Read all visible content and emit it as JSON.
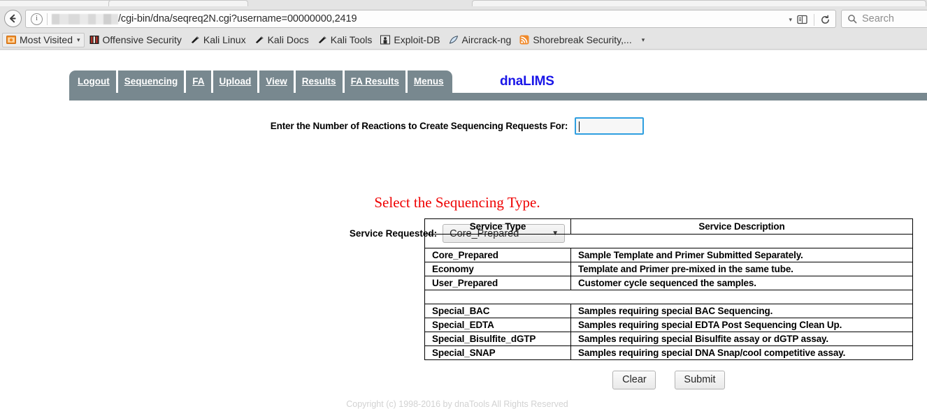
{
  "browser": {
    "url_prefix_redacted": true,
    "url": "/cgi-bin/dna/seqreq2N.cgi?username=00000000,2419",
    "search_placeholder": "Search",
    "back_icon": "back-arrow-icon",
    "info_icon": "page-info-icon",
    "reader_icon": "reader-view-icon",
    "reload_icon": "reload-icon",
    "dropdown_caret": "▾",
    "search_icon": "search-icon",
    "bookmarks": [
      {
        "label": "Most Visited",
        "icon": "most-visited-icon",
        "caret": "▾"
      },
      {
        "label": "Offensive Security",
        "icon": "offensive-security-icon"
      },
      {
        "label": "Kali Linux",
        "icon": "kali-icon"
      },
      {
        "label": "Kali Docs",
        "icon": "kali-icon"
      },
      {
        "label": "Kali Tools",
        "icon": "kali-icon"
      },
      {
        "label": "Exploit-DB",
        "icon": "exploit-db-icon"
      },
      {
        "label": "Aircrack-ng",
        "icon": "aircrack-icon"
      },
      {
        "label": "Shorebreak Security,...",
        "icon": "rss-feed-icon"
      }
    ],
    "bookmarks_overflow_caret": "▾"
  },
  "app": {
    "brand": "dnaLIMS",
    "brand_color": "#1a16e8",
    "navbar_color": "#78888f",
    "tabs": [
      {
        "label": "Logout"
      },
      {
        "label": "Sequencing"
      },
      {
        "label": "FA"
      },
      {
        "label": "Upload"
      },
      {
        "label": "View"
      },
      {
        "label": "Results"
      },
      {
        "label": "FA Results"
      },
      {
        "label": "Menus"
      }
    ]
  },
  "form": {
    "reactions_label": "Enter the Number of Reactions to Create Sequencing Requests For:",
    "reactions_value": "",
    "select_type_message": "Select the Sequencing Type.",
    "select_type_color": "#ef0000",
    "service_requested_label": "Service Requested:",
    "service_requested_value": "Core_Prepared",
    "select_caret": "▼",
    "clear_label": "Clear",
    "submit_label": "Submit"
  },
  "table": {
    "headers": [
      "Service Type",
      "Service Description"
    ],
    "rows": [
      {
        "spacer": true
      },
      {
        "type": "Core_Prepared",
        "description": "Sample Template and Primer Submitted Separately."
      },
      {
        "type": "Economy",
        "description": "Template and Primer pre-mixed in the same tube."
      },
      {
        "type": "User_Prepared",
        "description": "Customer cycle sequenced the samples."
      },
      {
        "spacer": true
      },
      {
        "type": "Special_BAC",
        "description": "Samples requiring special BAC Sequencing."
      },
      {
        "type": "Special_EDTA",
        "description": "Samples requiring special EDTA Post Sequencing Clean Up."
      },
      {
        "type": "Special_Bisulfite_dGTP",
        "description": "Samples requiring special Bisulfite assay or dGTP assay."
      },
      {
        "type": "Special_SNAP",
        "description": "Samples requiring special DNA Snap/cool competitive assay."
      }
    ]
  },
  "footer": {
    "copyright": "Copyright (c) 1998-2016 by dnaTools  All Rights Reserved"
  }
}
